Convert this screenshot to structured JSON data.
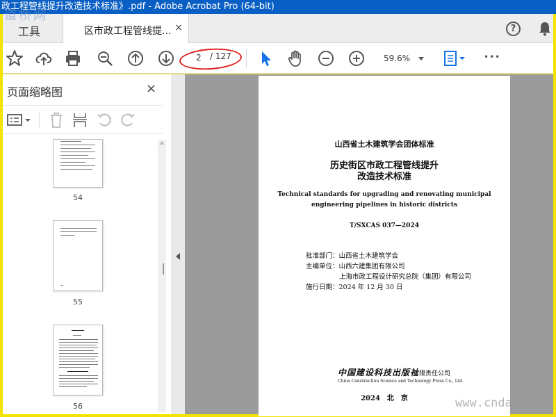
{
  "window": {
    "title": "政工程管线提升改造技术标准》.pdf - Adobe Acrobat Pro (64-bit)"
  },
  "watermarks": {
    "top_left": "道桥网",
    "bottom_right": "www.cnda"
  },
  "tabs": {
    "tools_label": "工具",
    "doc_label": "区市政工程管线提...",
    "close_glyph": "×"
  },
  "toolbar": {
    "current_page": "2",
    "page_total": "/ 127",
    "zoom": "59.6%",
    "help_glyph": "?",
    "more_glyph": "•••"
  },
  "sidebar": {
    "title": "页面缩略图",
    "close_glyph": "×",
    "thumbnails": [
      {
        "label": "54"
      },
      {
        "label": "55"
      },
      {
        "label": "56"
      }
    ]
  },
  "document": {
    "org": "山西省土木建筑学会团体标准",
    "title_line1": "历史街区市政工程管线提升",
    "title_line2": "改造技术标准",
    "en_line1": "Technical standards for upgrading and renovating municipal",
    "en_line2": "engineering pipelines in historic districts",
    "code": "T/SXCAS 037—2024",
    "approved_by": "批准部门：山西省土木建筑学会",
    "editor1": "主编单位：山西六建集团有限公司",
    "editor2": "上海市政工程设计研究总院（集团）有限公司",
    "effective": "施行日期：2024 年 12 月 30 日",
    "publisher_logo": "中国建设科技出版社",
    "publisher_suffix": "有限责任公司",
    "publisher_en": "China Construction Science and Technology Press Co., Ltd.",
    "year_place": "2024　北　京"
  },
  "colors": {
    "titlebar": "#0a5fc4",
    "frame": "#f2e400",
    "accent": "#1473e6",
    "annotation": "#e02020"
  }
}
